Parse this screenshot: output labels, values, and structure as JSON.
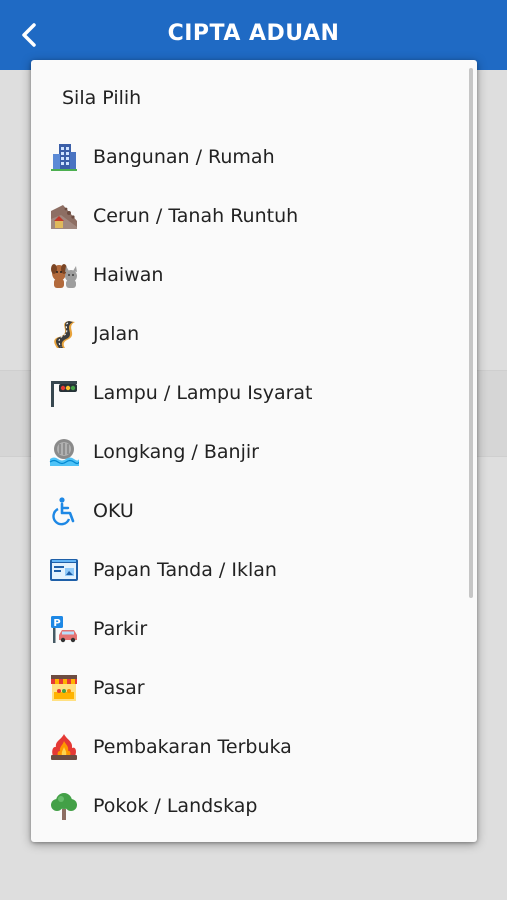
{
  "appbar": {
    "title": "CIPTA ADUAN",
    "back_icon": "chevron-left-icon",
    "color": "#1f6ac4"
  },
  "dropdown": {
    "placeholder": "Sila Pilih",
    "items": [
      {
        "label": "Bangunan / Rumah",
        "icon": "building-icon"
      },
      {
        "label": "Cerun / Tanah Runtuh",
        "icon": "landslide-icon"
      },
      {
        "label": "Haiwan",
        "icon": "animals-icon"
      },
      {
        "label": "Jalan",
        "icon": "road-icon"
      },
      {
        "label": "Lampu / Lampu Isyarat",
        "icon": "traffic-light-icon"
      },
      {
        "label": "Longkang / Banjir",
        "icon": "drain-flood-icon"
      },
      {
        "label": "OKU",
        "icon": "wheelchair-icon"
      },
      {
        "label": "Papan Tanda / Iklan",
        "icon": "billboard-icon"
      },
      {
        "label": "Parkir",
        "icon": "parking-icon"
      },
      {
        "label": "Pasar",
        "icon": "market-icon"
      },
      {
        "label": "Pembakaran Terbuka",
        "icon": "open-burning-icon"
      },
      {
        "label": "Pokok / Landskap",
        "icon": "tree-icon"
      }
    ]
  }
}
